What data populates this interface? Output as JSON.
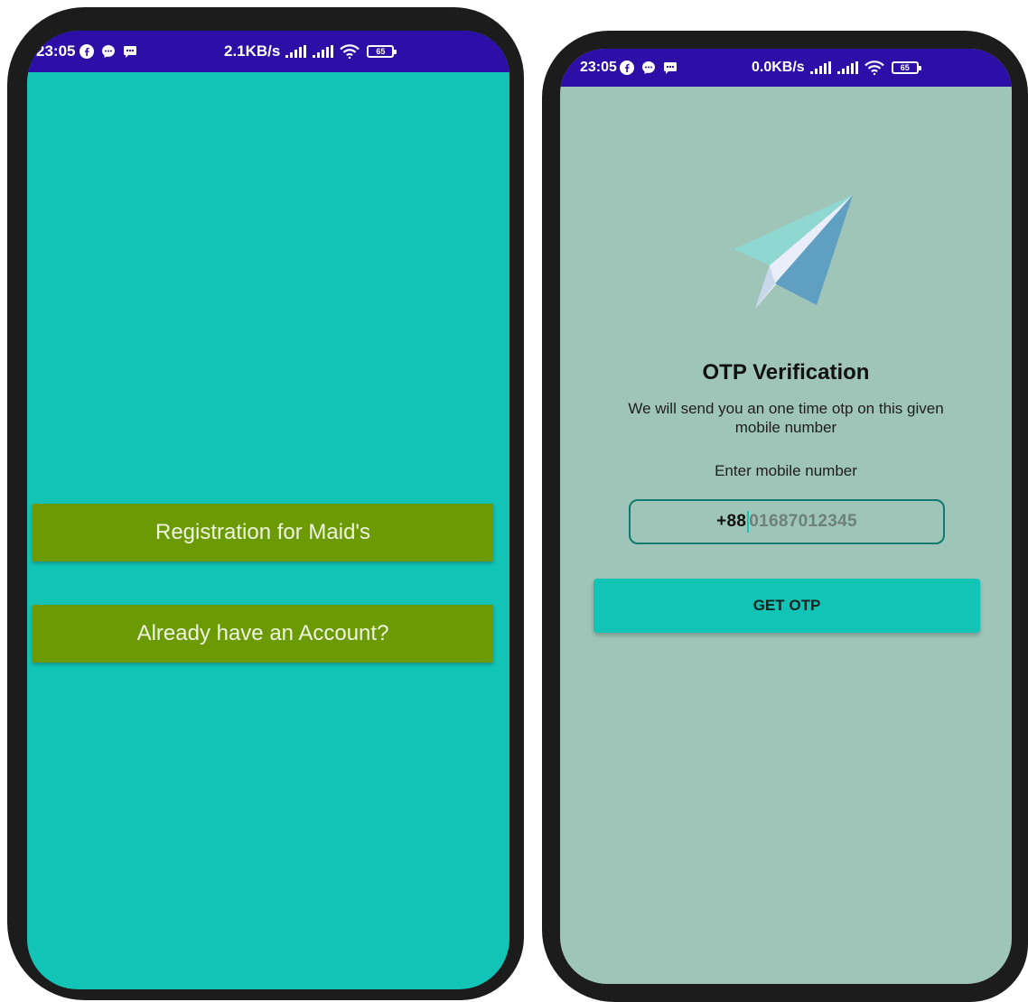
{
  "left_phone": {
    "status_bar": {
      "time": "23:05",
      "network_speed": "2.1KB/s",
      "battery": "65",
      "icons": [
        "facebook-icon",
        "messenger-icon",
        "sms-icon",
        "signal-icon",
        "signal-icon",
        "wifi-icon",
        "battery-icon"
      ]
    },
    "screen_color": "#12c4b5",
    "buttons": {
      "registration": "Registration for Maid's",
      "login": "Already have an Account?"
    },
    "button_color": "#6b9a05"
  },
  "right_phone": {
    "status_bar": {
      "time": "23:05",
      "network_speed": "0.0KB/s",
      "battery": "65",
      "icons": [
        "facebook-icon",
        "messenger-icon",
        "sms-icon",
        "signal-icon",
        "signal-icon",
        "wifi-icon",
        "battery-icon"
      ]
    },
    "screen_color": "#9fc4b8",
    "illustration": "paper-plane-icon",
    "title": "OTP Verification",
    "description": "We will send you an one time otp on this given mobile number",
    "input_label": "Enter mobile number",
    "mobile_input": {
      "country_code": "+88",
      "placeholder": "01687012345"
    },
    "get_otp_button": "GET OTP",
    "accent_color": "#12c4b5",
    "status_bar_color": "#2d0fa8"
  }
}
